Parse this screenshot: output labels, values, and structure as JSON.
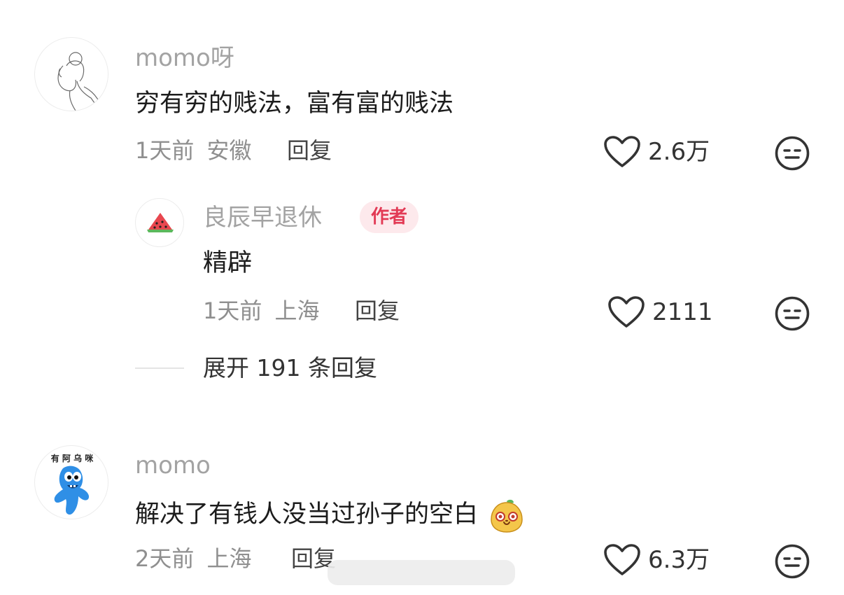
{
  "comments": [
    {
      "username": "momo呀",
      "text": "穷有穷的贱法，富有富的贱法",
      "time": "1天前",
      "location": "安徽",
      "reply_label": "回复",
      "likes": "2.6万",
      "replies": [
        {
          "username": "良辰早退休",
          "badge": "作者",
          "text": "精辟",
          "time": "1天前",
          "location": "上海",
          "reply_label": "回复",
          "likes": "2111"
        }
      ],
      "expand_label": "展开 191 条回复"
    },
    {
      "username": "momo",
      "avatar_text": "有 阿 乌 咪",
      "text": "解决了有钱人没当过孙子的空白",
      "time": "2天前",
      "location": "上海",
      "reply_label": "回复",
      "likes": "6.3万"
    }
  ],
  "colors": {
    "badge_bg": "#fde9ec",
    "badge_text": "#e23a55",
    "username": "#a3a3a3",
    "meta": "#8f8f8f"
  },
  "icons": [
    "heart-outline-icon",
    "meh-face-icon",
    "watermelon-avatar",
    "blue-monster-avatar",
    "sketch-woman-avatar",
    "pear-emoji"
  ]
}
